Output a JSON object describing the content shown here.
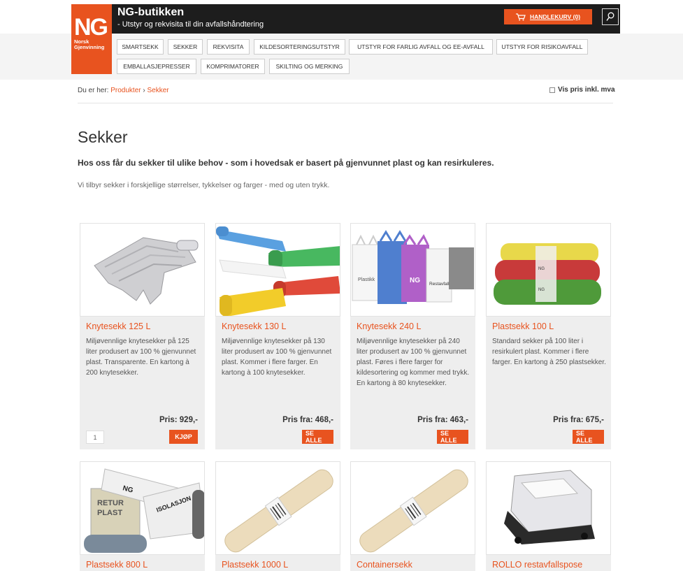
{
  "header": {
    "logo_text": "NG",
    "logo_sub": "Norsk Gjenvinning",
    "title": "NG-butikken",
    "subtitle": "- Utstyr og rekvisita til din avfallshåndtering",
    "cart_label": "HANDLEKURV (0)",
    "brand_color": "#e8531f"
  },
  "nav": {
    "items": [
      "SMARTSEKK",
      "SEKKER",
      "REKVISITA",
      "KILDESORTERINGSUTSTYR",
      "UTSTYR FOR FARLIG AVFALL OG EE-AVFALL",
      "UTSTYR FOR RISIKOAVFALL",
      "EMBALLASJEPRESSER",
      "KOMPRIMATORER",
      "SKILTING OG MERKING"
    ]
  },
  "breadcrumb": {
    "prefix": "Du er her:",
    "items": [
      "Produkter",
      "Sekker"
    ],
    "separator": "›"
  },
  "vat_toggle": {
    "label": "Vis pris inkl. mva",
    "checked": false
  },
  "page": {
    "title": "Sekker",
    "lead": "Hos oss får du sekker til ulike behov - som i hovedsak er basert på gjenvunnet plast og kan resirkuleres.",
    "description": "Vi tilbyr sekker i forskjellige størrelser, tykkelser og farger - med og uten trykk."
  },
  "products": [
    {
      "title": "Knytesekk 125 L",
      "text": "Miljøvennlige knytesekker på 125 liter produsert av 100 % gjenvunnet plast. Transparente. En kartong à 200 knytesekker.",
      "price": "Pris: 929,-",
      "button": "KJØP",
      "qty": "1",
      "image": "transparent-bag"
    },
    {
      "title": "Knytesekk 130 L",
      "text": "Miljøvennlige knytesekker på 130 liter produsert av 100 % gjenvunnet plast. Kommer i flere farger. En kartong à 100 knytesekker.",
      "price": "Pris fra: 468,-",
      "button": "SE ALLE",
      "image": "colored-rolls"
    },
    {
      "title": "Knytesekk 240 L",
      "text": "Miljøvennlige knytesekker på 240 liter produsert av 100 % gjenvunnet plast. Føres i flere farger for kildesortering og kommer med trykk. En kartong à 80 knytesekker.",
      "price": "Pris fra: 463,-",
      "button": "SE ALLE",
      "image": "printed-bags"
    },
    {
      "title": "Plastsekk 100 L",
      "text": "Standard sekker på 100 liter i resirkulert plast. Kommer i flere farger. En kartong à 250 plastsekker.",
      "price": "Pris fra: 675,-",
      "button": "SE ALLE",
      "image": "rolls-stack"
    },
    {
      "title": "Plastsekk 800 L",
      "image": "retur-plast"
    },
    {
      "title": "Plastsekk 1000 L",
      "image": "beige-roll"
    },
    {
      "title": "Containersekk",
      "image": "beige-roll"
    },
    {
      "title": "ROLLO restavfallspose",
      "image": "rollo-holder"
    }
  ]
}
